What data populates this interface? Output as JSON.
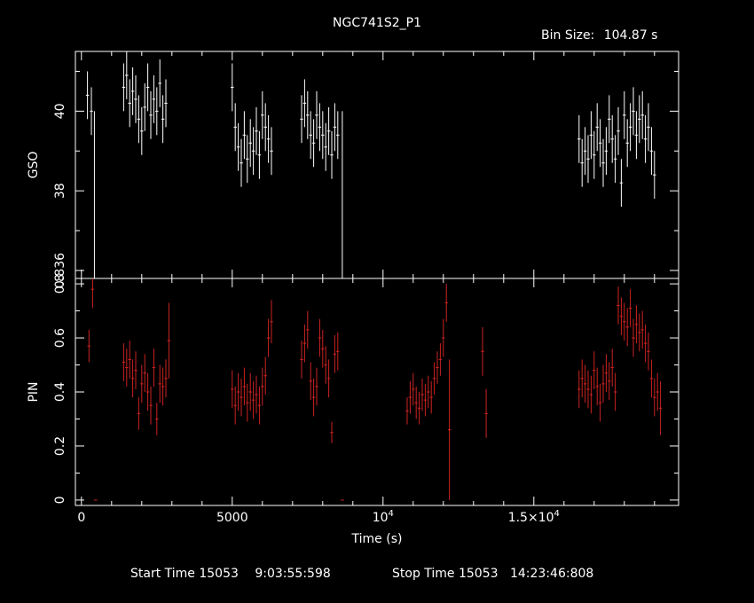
{
  "header": {
    "title": "NGC741S2_P1",
    "bin_label": "Bin Size:",
    "bin_value": "104.87 s"
  },
  "footer": {
    "start_label": "Start Time 15053",
    "start_value": "9:03:55:598",
    "stop_label": "Stop Time 15053",
    "stop_value": "14:23:46:808"
  },
  "chart_data": [
    {
      "type": "scatter",
      "panel": "GSO",
      "ylabel": "GSO",
      "xlim": [
        -200,
        19800
      ],
      "ylim": [
        35.8,
        41.5
      ],
      "yticks": [
        {
          "value": 40,
          "label": "40"
        },
        {
          "value": 38,
          "label": "38"
        },
        {
          "value": 36,
          "label": "0.836"
        }
      ],
      "color": "#ffffff",
      "grid": false,
      "points": [
        [
          200,
          40.4,
          0.6
        ],
        [
          330,
          40.0,
          0.6
        ],
        [
          430,
          30,
          10
        ],
        [
          1400,
          40.6,
          0.6
        ],
        [
          1500,
          40.9,
          0.6
        ],
        [
          1600,
          40.2,
          0.6
        ],
        [
          1700,
          40.5,
          0.6
        ],
        [
          1800,
          40.3,
          0.6
        ],
        [
          1900,
          39.8,
          0.6
        ],
        [
          2000,
          39.5,
          0.6
        ],
        [
          2100,
          40.1,
          0.6
        ],
        [
          2200,
          40.6,
          0.6
        ],
        [
          2300,
          39.9,
          0.6
        ],
        [
          2400,
          40.3,
          0.6
        ],
        [
          2500,
          40.0,
          0.6
        ],
        [
          2600,
          40.7,
          0.6
        ],
        [
          2700,
          39.8,
          0.6
        ],
        [
          2800,
          40.2,
          0.6
        ],
        [
          5000,
          40.6,
          0.6
        ],
        [
          5100,
          39.6,
          0.6
        ],
        [
          5200,
          39.1,
          0.6
        ],
        [
          5300,
          38.7,
          0.6
        ],
        [
          5400,
          39.4,
          0.6
        ],
        [
          5500,
          38.8,
          0.6
        ],
        [
          5600,
          39.2,
          0.6
        ],
        [
          5700,
          39.0,
          0.6
        ],
        [
          5800,
          39.5,
          0.6
        ],
        [
          5900,
          38.9,
          0.6
        ],
        [
          6000,
          39.9,
          0.6
        ],
        [
          6100,
          39.6,
          0.6
        ],
        [
          6200,
          39.3,
          0.6
        ],
        [
          6300,
          39.0,
          0.6
        ],
        [
          7300,
          39.8,
          0.6
        ],
        [
          7400,
          40.2,
          0.6
        ],
        [
          7500,
          39.9,
          0.6
        ],
        [
          7600,
          39.4,
          0.6
        ],
        [
          7700,
          39.2,
          0.6
        ],
        [
          7800,
          39.9,
          0.6
        ],
        [
          7900,
          39.6,
          0.6
        ],
        [
          8000,
          39.4,
          0.6
        ],
        [
          8100,
          39.1,
          0.6
        ],
        [
          8200,
          39.5,
          0.6
        ],
        [
          8300,
          38.9,
          0.6
        ],
        [
          8400,
          39.6,
          0.6
        ],
        [
          8500,
          39.4,
          0.6
        ],
        [
          8650,
          30,
          10
        ],
        [
          16500,
          39.3,
          0.6
        ],
        [
          16600,
          38.7,
          0.6
        ],
        [
          16700,
          39.0,
          0.6
        ],
        [
          16800,
          38.8,
          0.6
        ],
        [
          16900,
          39.4,
          0.6
        ],
        [
          17000,
          38.9,
          0.6
        ],
        [
          17100,
          39.6,
          0.6
        ],
        [
          17200,
          39.2,
          0.6
        ],
        [
          17300,
          38.7,
          0.6
        ],
        [
          17400,
          39.0,
          0.6
        ],
        [
          17500,
          39.8,
          0.6
        ],
        [
          17600,
          39.3,
          0.6
        ],
        [
          17700,
          38.8,
          0.6
        ],
        [
          17800,
          39.5,
          0.6
        ],
        [
          17900,
          38.2,
          0.6
        ],
        [
          18000,
          39.9,
          0.6
        ],
        [
          18100,
          39.2,
          0.6
        ],
        [
          18200,
          39.6,
          0.6
        ],
        [
          18300,
          40.0,
          0.6
        ],
        [
          18400,
          39.4,
          0.6
        ],
        [
          18500,
          39.8,
          0.6
        ],
        [
          18600,
          39.9,
          0.6
        ],
        [
          18700,
          39.3,
          0.6
        ],
        [
          18800,
          39.6,
          0.6
        ],
        [
          18900,
          39.0,
          0.6
        ],
        [
          19000,
          38.4,
          0.6
        ]
      ]
    },
    {
      "type": "scatter",
      "panel": "PIN",
      "ylabel": "PIN",
      "xlabel": "Time (s)",
      "xlim": [
        -200,
        19800
      ],
      "ylim": [
        -0.02,
        0.82
      ],
      "yticks": [
        {
          "value": 0,
          "label": "0"
        },
        {
          "value": 0.2,
          "label": "0.2"
        },
        {
          "value": 0.4,
          "label": "0.4"
        },
        {
          "value": 0.6,
          "label": "0.6"
        },
        {
          "value": 0.8,
          "label": "0.8"
        }
      ],
      "xticks": [
        {
          "value": 0,
          "label": "0"
        },
        {
          "value": 5000,
          "label": "5000"
        },
        {
          "value": 10000,
          "label": "10",
          "sup": "4"
        },
        {
          "value": 15000,
          "label": "1.5×10",
          "sup": "4"
        }
      ],
      "color": "#cc2222",
      "grid": false,
      "points": [
        [
          250,
          0.57,
          0.06
        ],
        [
          370,
          0.78,
          0.07
        ],
        [
          470,
          0.0,
          0.0
        ],
        [
          1400,
          0.51,
          0.07
        ],
        [
          1500,
          0.49,
          0.07
        ],
        [
          1600,
          0.52,
          0.07
        ],
        [
          1700,
          0.45,
          0.07
        ],
        [
          1800,
          0.48,
          0.07
        ],
        [
          1900,
          0.32,
          0.06
        ],
        [
          2000,
          0.43,
          0.07
        ],
        [
          2100,
          0.47,
          0.07
        ],
        [
          2200,
          0.4,
          0.07
        ],
        [
          2300,
          0.35,
          0.07
        ],
        [
          2400,
          0.49,
          0.07
        ],
        [
          2500,
          0.3,
          0.06
        ],
        [
          2600,
          0.43,
          0.07
        ],
        [
          2700,
          0.42,
          0.07
        ],
        [
          2800,
          0.45,
          0.07
        ],
        [
          2900,
          0.59,
          0.14
        ],
        [
          5000,
          0.41,
          0.07
        ],
        [
          5100,
          0.35,
          0.07
        ],
        [
          5200,
          0.4,
          0.07
        ],
        [
          5300,
          0.38,
          0.07
        ],
        [
          5400,
          0.42,
          0.07
        ],
        [
          5500,
          0.36,
          0.07
        ],
        [
          5600,
          0.4,
          0.07
        ],
        [
          5700,
          0.37,
          0.07
        ],
        [
          5800,
          0.39,
          0.07
        ],
        [
          5900,
          0.35,
          0.07
        ],
        [
          6000,
          0.42,
          0.07
        ],
        [
          6100,
          0.46,
          0.07
        ],
        [
          6200,
          0.6,
          0.07
        ],
        [
          6300,
          0.66,
          0.08
        ],
        [
          7300,
          0.52,
          0.07
        ],
        [
          7400,
          0.58,
          0.07
        ],
        [
          7500,
          0.63,
          0.07
        ],
        [
          7600,
          0.44,
          0.07
        ],
        [
          7700,
          0.38,
          0.07
        ],
        [
          7800,
          0.42,
          0.07
        ],
        [
          7900,
          0.6,
          0.07
        ],
        [
          8000,
          0.56,
          0.07
        ],
        [
          8100,
          0.5,
          0.07
        ],
        [
          8200,
          0.45,
          0.07
        ],
        [
          8300,
          0.25,
          0.04
        ],
        [
          8400,
          0.54,
          0.07
        ],
        [
          8500,
          0.55,
          0.07
        ],
        [
          8650,
          0.0,
          0.0
        ],
        [
          10800,
          0.33,
          0.05
        ],
        [
          10900,
          0.38,
          0.06
        ],
        [
          11000,
          0.41,
          0.06
        ],
        [
          11100,
          0.36,
          0.06
        ],
        [
          11200,
          0.34,
          0.06
        ],
        [
          11300,
          0.39,
          0.06
        ],
        [
          11400,
          0.37,
          0.06
        ],
        [
          11500,
          0.4,
          0.06
        ],
        [
          11600,
          0.38,
          0.06
        ],
        [
          11700,
          0.45,
          0.06
        ],
        [
          11800,
          0.49,
          0.06
        ],
        [
          11900,
          0.52,
          0.06
        ],
        [
          12000,
          0.6,
          0.07
        ],
        [
          12100,
          0.73,
          0.07
        ],
        [
          12200,
          0.26,
          0.26
        ],
        [
          13300,
          0.55,
          0.09
        ],
        [
          13420,
          0.32,
          0.09
        ],
        [
          16500,
          0.41,
          0.07
        ],
        [
          16600,
          0.45,
          0.07
        ],
        [
          16700,
          0.43,
          0.07
        ],
        [
          16800,
          0.41,
          0.07
        ],
        [
          16900,
          0.39,
          0.07
        ],
        [
          17000,
          0.48,
          0.07
        ],
        [
          17100,
          0.42,
          0.07
        ],
        [
          17200,
          0.36,
          0.07
        ],
        [
          17300,
          0.43,
          0.07
        ],
        [
          17400,
          0.47,
          0.07
        ],
        [
          17500,
          0.44,
          0.07
        ],
        [
          17600,
          0.49,
          0.07
        ],
        [
          17700,
          0.4,
          0.07
        ],
        [
          17800,
          0.72,
          0.07
        ],
        [
          17900,
          0.68,
          0.07
        ],
        [
          18000,
          0.66,
          0.07
        ],
        [
          18100,
          0.64,
          0.07
        ],
        [
          18200,
          0.71,
          0.07
        ],
        [
          18300,
          0.6,
          0.07
        ],
        [
          18400,
          0.65,
          0.07
        ],
        [
          18500,
          0.62,
          0.07
        ],
        [
          18600,
          0.63,
          0.07
        ],
        [
          18700,
          0.58,
          0.07
        ],
        [
          18800,
          0.55,
          0.07
        ],
        [
          18900,
          0.45,
          0.07
        ],
        [
          19000,
          0.38,
          0.07
        ],
        [
          19100,
          0.4,
          0.07
        ],
        [
          19200,
          0.34,
          0.1
        ]
      ]
    }
  ]
}
